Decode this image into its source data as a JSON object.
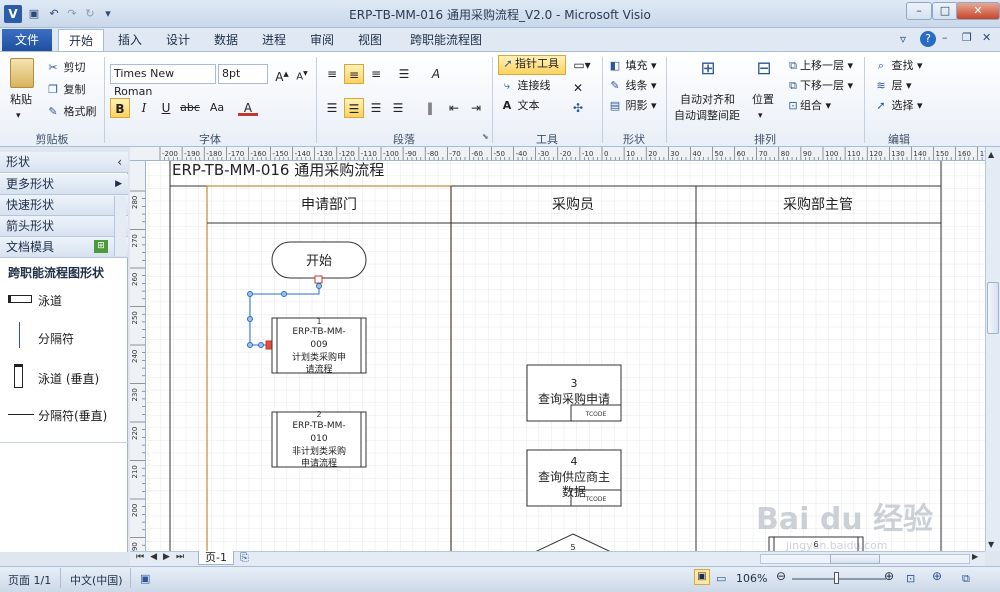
{
  "window": {
    "title": "ERP-TB-MM-016 通用采购流程_V2.0 - Microsoft Visio",
    "app_icon": "V",
    "minimize": "–",
    "maximize": "□",
    "close": "✕"
  },
  "quick_access": [
    "save-icon",
    "undo-icon",
    "redo-icon",
    "customize-icon"
  ],
  "tabs": {
    "file": "文件",
    "items": [
      "开始",
      "插入",
      "设计",
      "数据",
      "进程",
      "审阅",
      "视图",
      "跨职能流程图"
    ],
    "active": "开始"
  },
  "ribbon": {
    "clipboard": {
      "label": "剪贴板",
      "paste": "粘贴",
      "cut": "剪切",
      "copy": "复制",
      "format_painter": "格式刷"
    },
    "font": {
      "label": "字体",
      "family": "Times New Roman",
      "size": "8pt",
      "bold": "B",
      "italic": "I",
      "underline": "U",
      "strike": "abc",
      "case": "Aa",
      "color": "A"
    },
    "paragraph": {
      "label": "段落"
    },
    "tools": {
      "label": "工具",
      "pointer": "指针工具",
      "connector": "连接线",
      "text": "文本"
    },
    "shape": {
      "label": "形状",
      "fill": "填充",
      "line": "线条",
      "shadow": "阴影"
    },
    "arrange": {
      "label": "排列",
      "auto_align": "自动对齐和",
      "auto_space": "自动调整间距",
      "position": "位置",
      "bring_forward": "上移一层",
      "send_backward": "下移一层",
      "group": "组合"
    },
    "edit": {
      "label": "编辑",
      "find": "查找",
      "layer": "层",
      "select": "选择"
    }
  },
  "shapes_pane": {
    "title": "形状",
    "categories": [
      "更多形状",
      "快速形状",
      "箭头形状",
      "文档模具"
    ],
    "stencil_title": "跨职能流程图形状",
    "items": [
      "泳道",
      "分隔符",
      "泳道 (垂直)",
      "分隔符(垂直)"
    ]
  },
  "diagram": {
    "header_text": "ERP-TB-MM-016 通用采购流程",
    "lanes": [
      "申请部门",
      "采购员",
      "采购部主管"
    ],
    "start": "开始",
    "boxes": [
      {
        "num": "1",
        "lines": [
          "ERP-TB-MM-",
          "009",
          "计划类采购申",
          "请流程"
        ]
      },
      {
        "num": "2",
        "lines": [
          "ERP-TB-MM-",
          "010",
          "非计划类采购",
          "申请流程"
        ]
      },
      {
        "num": "3",
        "lines": [
          "查询采购申请"
        ],
        "tag": "TCODE"
      },
      {
        "num": "4",
        "lines": [
          "查询供应商主",
          "数据"
        ],
        "tag": "TCODE"
      },
      {
        "num": "5"
      },
      {
        "num": "6"
      }
    ]
  },
  "rulers": {
    "top": [
      "-200",
      "-190",
      "-180",
      "-170",
      "-160",
      "-150",
      "-140",
      "-130",
      "-120",
      "-110",
      "-100",
      "-90",
      "-80",
      "-70",
      "-60",
      "-50",
      "-40",
      "-30",
      "-20",
      "-10",
      "0",
      "10",
      "20",
      "30",
      "40",
      "50",
      "60",
      "70",
      "80",
      "90",
      "100",
      "110",
      "120",
      "130",
      "140",
      "150",
      "160",
      "170",
      "180"
    ],
    "left": [
      "280",
      "270",
      "260",
      "250",
      "240",
      "230",
      "220",
      "210",
      "200",
      "190"
    ]
  },
  "page_tab": "页-1",
  "status": {
    "page": "页面 1/1",
    "language": "中文(中国)",
    "zoom": "106%"
  },
  "watermark": {
    "brand": "Bai du 经验",
    "url": "jingyan.baidu.com"
  }
}
